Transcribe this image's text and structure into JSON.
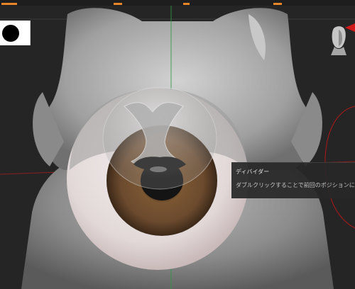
{
  "tooltip": {
    "title": "ディバイダー",
    "description": "ダブルクリックすることで前回のポジションに戻すこと"
  },
  "icons": {
    "brush": "round-brush-icon",
    "navigation": "head-navigation-icon",
    "axis_gizmo": "axis-gizmo-icon"
  },
  "colors": {
    "background": "#252525",
    "accent": "#e8862a",
    "axis_x": "#c02020",
    "axis_y": "#2e9a4a",
    "iris": "#6b4a2e"
  }
}
